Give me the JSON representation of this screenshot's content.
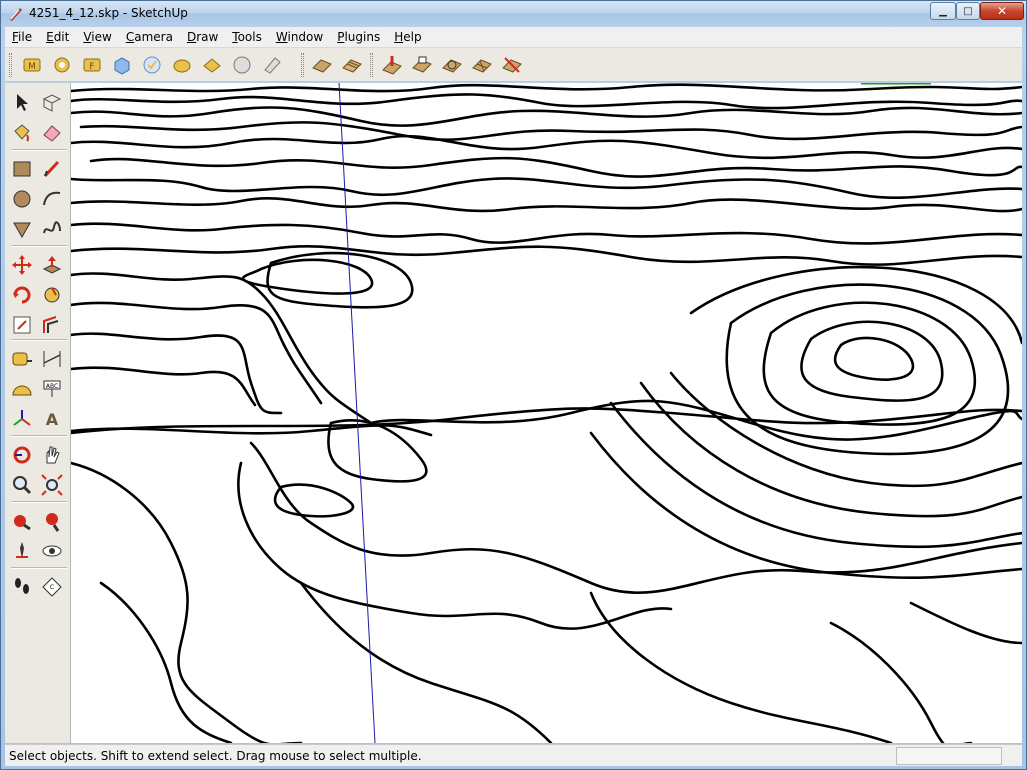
{
  "window": {
    "title": "4251_4_12.skp - SketchUp",
    "minimize_label": "▁",
    "maximize_label": "□",
    "close_label": "✕"
  },
  "menus": [
    {
      "id": "file",
      "first": "F",
      "rest": "ile"
    },
    {
      "id": "edit",
      "first": "E",
      "rest": "dit"
    },
    {
      "id": "view",
      "first": "V",
      "rest": "iew"
    },
    {
      "id": "camera",
      "first": "C",
      "rest": "amera"
    },
    {
      "id": "draw",
      "first": "D",
      "rest": "raw"
    },
    {
      "id": "tools",
      "first": "T",
      "rest": "ools"
    },
    {
      "id": "window",
      "first": "W",
      "rest": "indow"
    },
    {
      "id": "plugins",
      "first": "P",
      "rest": "lugins"
    },
    {
      "id": "help",
      "first": "H",
      "rest": "elp"
    }
  ],
  "toolbar_icons": [
    "google-earth-model-icon",
    "get-current-view-icon",
    "toggle-terrain-icon",
    "place-model-icon",
    "get-models-icon",
    "share-model-icon",
    "share-component-icon",
    "sphere-icon",
    "eraser-smooth-icon",
    "sandbox-from-contours-icon",
    "sandbox-from-scratch-icon",
    "smoove-icon",
    "stamp-icon",
    "drape-icon",
    "add-detail-icon",
    "flip-edge-icon"
  ],
  "left_tools": [
    "select-icon",
    "make-component-icon",
    "paint-bucket-icon",
    "eraser-icon",
    "rectangle-icon",
    "line-icon",
    "circle-icon",
    "arc-icon",
    "polygon-icon",
    "freehand-icon",
    "move-icon",
    "push-pull-icon",
    "rotate-icon",
    "follow-me-icon",
    "scale-icon",
    "offset-icon",
    "tape-measure-icon",
    "dimension-icon",
    "protractor-icon",
    "text-icon",
    "axes-icon",
    "3d-text-icon",
    "orbit-icon",
    "pan-icon",
    "zoom-icon",
    "zoom-window-icon",
    "previous-view-icon",
    "zoom-extents-icon",
    "position-camera-icon",
    "look-around-icon",
    "walk-icon",
    "section-plane-icon"
  ],
  "status": {
    "hint": "Select objects. Shift to extend select. Drag mouse to select multiple.",
    "vcb_label": "",
    "vcb_value": ""
  },
  "colors": {
    "accent_blue_axis": "#1a1aa8",
    "green_axis": "#1ea01e",
    "contour": "#000000",
    "tool_red": "#d22a1a",
    "tool_yellow": "#e8c04a"
  }
}
